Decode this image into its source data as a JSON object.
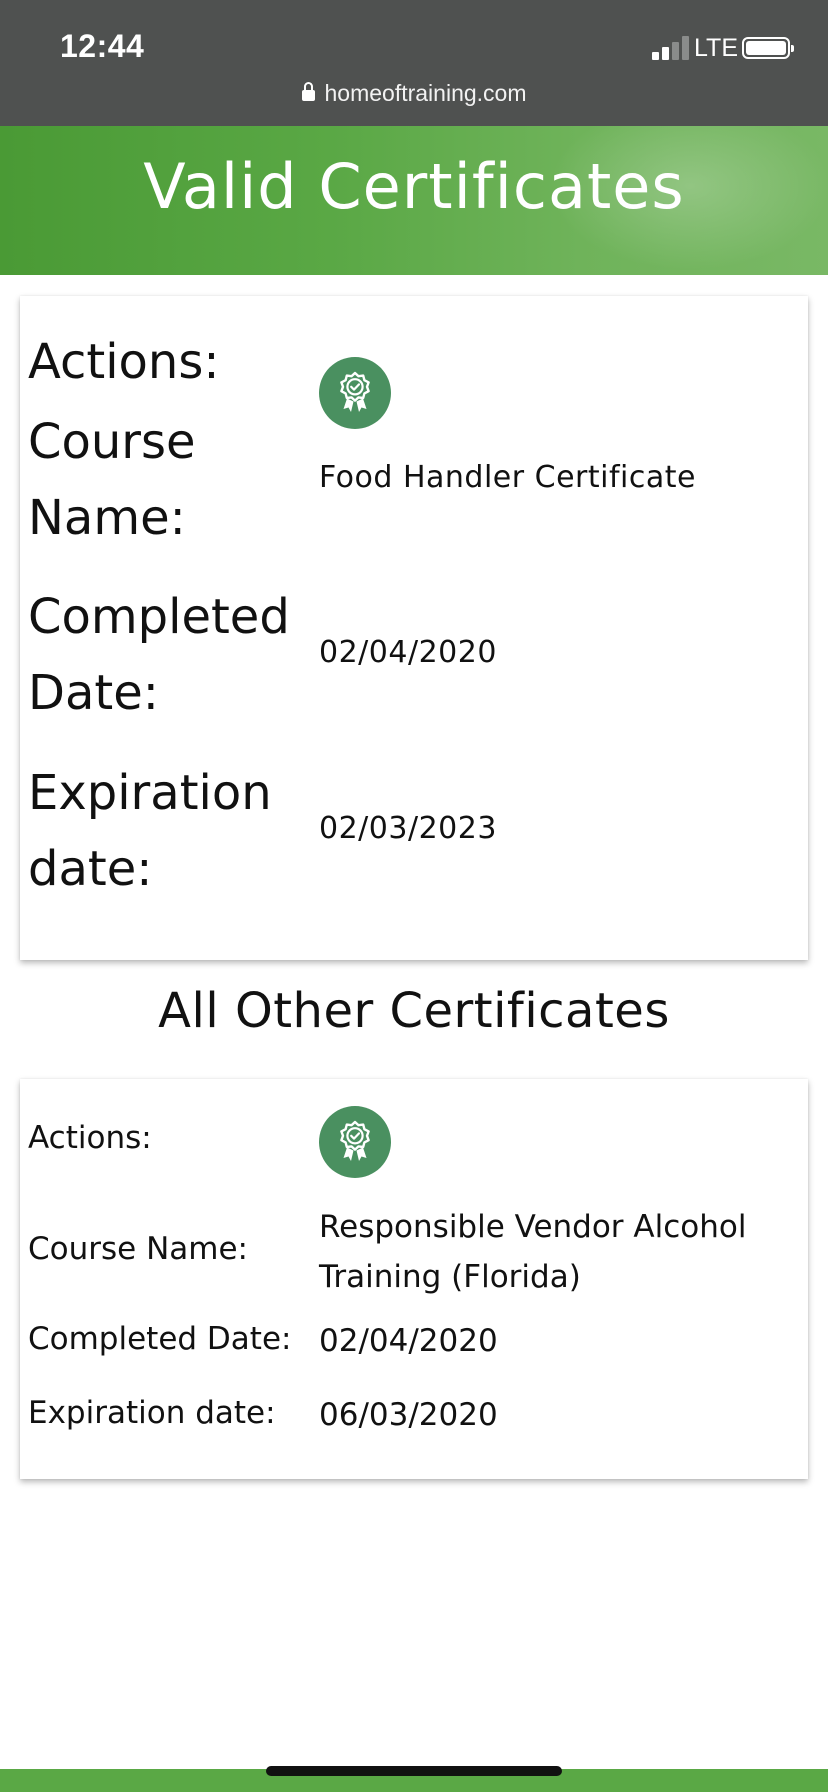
{
  "status_bar": {
    "time": "12:44",
    "network": "LTE",
    "url": "homeoftraining.com"
  },
  "header": {
    "title": "Valid Certificates"
  },
  "valid_certificate": {
    "actions_label": "Actions:",
    "course_name_label": "Course Name:",
    "course_name": "Food Handler Certificate",
    "completed_label": "Completed Date:",
    "completed_date": "02/04/2020",
    "expiration_label": "Expiration date:",
    "expiration_date": "02/03/2023",
    "action_icon": "certificate-award-icon"
  },
  "other_section": {
    "title": "All Other Certificates"
  },
  "other_certificates": [
    {
      "actions_label": "Actions:",
      "course_name_label": "Course Name:",
      "course_name": "Responsible Vendor Alcohol Training (Florida)",
      "completed_label": "Completed Date:",
      "completed_date": "02/04/2020",
      "expiration_label": "Expiration date:",
      "expiration_date": "06/03/2020",
      "action_icon": "certificate-award-icon"
    }
  ],
  "colors": {
    "brand_green": "#5aa845",
    "badge_green": "#4a9060",
    "status_bar": "#4f5150"
  }
}
